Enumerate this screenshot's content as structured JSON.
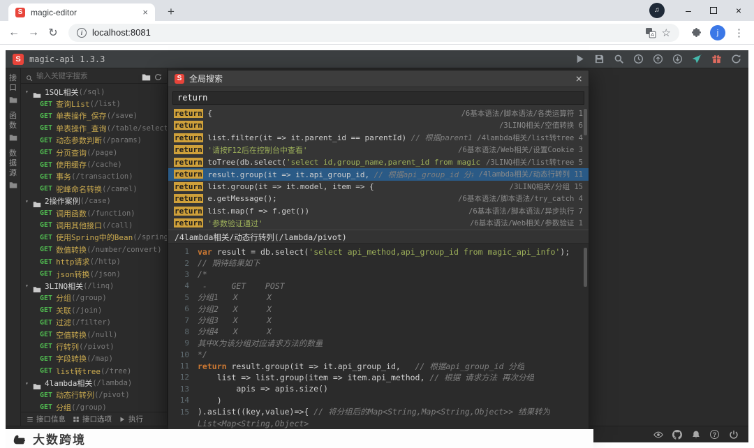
{
  "colors": {
    "brand_red": "#e8443a",
    "highlight_bg": "#cfa03a",
    "selected_row": "#2a5a86",
    "keyword": "#cc7832",
    "string": "#9eb15a",
    "comment": "#7f7f7f",
    "method_get": "#4fb84f",
    "app_bg": "#2b2b2b",
    "avatar_blue": "#3b78e7"
  },
  "browser": {
    "tab_title": "magic-editor",
    "url": "localhost:8081",
    "avatar_letter": "j",
    "icons": [
      "back-icon",
      "forward-icon",
      "reload-icon",
      "info-icon",
      "translate-icon",
      "bookmark-star-icon",
      "extensions-puzzle-icon",
      "profile-avatar",
      "menu-kebab-icon",
      "media-controls-icon",
      "minimize-icon",
      "maximize-icon",
      "close-icon",
      "new-tab-icon",
      "tab-close-icon"
    ]
  },
  "app": {
    "brand_letter": "S",
    "title": "magic-api 1.3.3",
    "header_icons": [
      {
        "name": "run-icon",
        "color": "#9aa0a6"
      },
      {
        "name": "save-icon",
        "color": "#9aa0a6"
      },
      {
        "name": "search-icon",
        "color": "#9aa0a6"
      },
      {
        "name": "history-icon",
        "color": "#9aa0a6"
      },
      {
        "name": "upload-icon",
        "color": "#9aa0a6"
      },
      {
        "name": "download-icon",
        "color": "#9aa0a6"
      },
      {
        "name": "send-icon",
        "color": "#45b8ac"
      },
      {
        "name": "gift-icon",
        "color": "#e06c60"
      },
      {
        "name": "refresh-icon",
        "color": "#9aa0a6"
      }
    ],
    "footer_icons": [
      {
        "name": "eye-icon"
      },
      {
        "name": "github-icon"
      },
      {
        "name": "bell-icon"
      },
      {
        "name": "help-icon"
      },
      {
        "name": "power-icon"
      }
    ]
  },
  "sidebar": {
    "search_placeholder": "输入关键字搜索",
    "panel_tabs": [
      {
        "label": "接口"
      },
      {
        "label": "函数"
      },
      {
        "label": "数据源"
      }
    ],
    "tree": [
      {
        "label": "1SQL相关",
        "path": "(/sql)",
        "children": [
          {
            "method": "GET",
            "label": "查询List",
            "path": "(/list)"
          },
          {
            "method": "GET",
            "label": "单表操作_保存",
            "path": "(/save)"
          },
          {
            "method": "GET",
            "label": "单表操作_查询",
            "path": "(/table/select"
          },
          {
            "method": "GET",
            "label": "动态参数判断",
            "path": "(/params)"
          },
          {
            "method": "GET",
            "label": "分页查询",
            "path": "(/page)"
          },
          {
            "method": "GET",
            "label": "使用缓存",
            "path": "(/cache)"
          },
          {
            "method": "GET",
            "label": "事务",
            "path": "(/transaction)"
          },
          {
            "method": "GET",
            "label": "驼峰命名转换",
            "path": "(/camel)"
          }
        ]
      },
      {
        "label": "2操作案例",
        "path": "(/case)",
        "children": [
          {
            "method": "GET",
            "label": "调用函数",
            "path": "(/function)"
          },
          {
            "method": "GET",
            "label": "调用其他接口",
            "path": "(/call)"
          },
          {
            "method": "GET",
            "label": "使用Spring中的Bean",
            "path": "(/spring"
          },
          {
            "method": "GET",
            "label": "数值转换",
            "path": "(/number/convert)"
          },
          {
            "method": "GET",
            "label": "http请求",
            "path": "(/http)"
          },
          {
            "method": "GET",
            "label": "json转换",
            "path": "(/json)"
          }
        ]
      },
      {
        "label": "3LINQ相关",
        "path": "(/linq)",
        "children": [
          {
            "method": "GET",
            "label": "分组",
            "path": "(/group)"
          },
          {
            "method": "GET",
            "label": "关联",
            "path": "(/join)"
          },
          {
            "method": "GET",
            "label": "过滤",
            "path": "(/filter)"
          },
          {
            "method": "GET",
            "label": "空值转换",
            "path": "(/null)"
          },
          {
            "method": "GET",
            "label": "行转列",
            "path": "(/pivot)"
          },
          {
            "method": "GET",
            "label": "字段转换",
            "path": "(/map)"
          },
          {
            "method": "GET",
            "label": "list转tree",
            "path": "(/tree)"
          }
        ]
      },
      {
        "label": "4lambda相关",
        "path": "(/lambda)",
        "children": [
          {
            "method": "GET",
            "label": "动态行转列",
            "path": "(/pivot)"
          },
          {
            "method": "GET",
            "label": "分组",
            "path": "(/group)"
          }
        ]
      }
    ],
    "footer": [
      {
        "name": "api-info",
        "icon": "list-icon",
        "label": "接口信息"
      },
      {
        "name": "api-options",
        "icon": "grid-icon",
        "label": "接口选项"
      },
      {
        "name": "run",
        "icon": "play-icon",
        "label": "执行"
      }
    ]
  },
  "modal": {
    "title": "全局搜索",
    "query": "return",
    "results": [
      {
        "keyword": "return",
        "segments": [
          {
            "text": " {",
            "type": "plain"
          }
        ],
        "path": "/6基本语法/脚本语法/各类运算符",
        "line": "1",
        "selected": false
      },
      {
        "keyword": "return",
        "segments": [],
        "path": "/3LINQ相关/空值转换",
        "line": "6",
        "selected": false
      },
      {
        "keyword": "return",
        "segments": [
          {
            "text": " list.filter(it => it.parent_id == parentId) ",
            "type": "plain"
          },
          {
            "text": "// 根据parentId",
            "type": "comment"
          }
        ],
        "path": "/4lambda相关/list转tree",
        "line": "4",
        "selected": false
      },
      {
        "keyword": "return",
        "segments": [
          {
            "text": " ",
            "type": "plain"
          },
          {
            "text": "'请按F12后在控制台中查看'",
            "type": "string"
          }
        ],
        "path": "/6基本语法/Web相关/设置Cookie",
        "line": "3",
        "selected": false
      },
      {
        "keyword": "return",
        "segments": [
          {
            "text": " toTree(db.select(",
            "type": "plain"
          },
          {
            "text": "'select id,group_name,parent_id from magic_g",
            "type": "string"
          }
        ],
        "path": "/3LINQ相关/list转tree",
        "line": "5",
        "selected": false
      },
      {
        "keyword": "return",
        "segments": [
          {
            "text": " result.group(it => it.api_group_id, ",
            "type": "plain"
          },
          {
            "text": "// 根据api_group_id 分组",
            "type": "comment"
          }
        ],
        "path": "/4lambda相关/动态行转列",
        "line": "11",
        "selected": true
      },
      {
        "keyword": "return",
        "segments": [
          {
            "text": " list.group(it => it.model, item => {",
            "type": "plain"
          }
        ],
        "path": "/3LINQ相关/分组",
        "line": "15",
        "selected": false
      },
      {
        "keyword": "return",
        "segments": [
          {
            "text": " e.getMessage();",
            "type": "plain"
          }
        ],
        "path": "/6基本语法/脚本语法/try_catch",
        "line": "4",
        "selected": false
      },
      {
        "keyword": "return",
        "segments": [
          {
            "text": " list.map(f => f.get())",
            "type": "plain"
          }
        ],
        "path": "/6基本语法/脚本语法/异步执行",
        "line": "7",
        "selected": false
      },
      {
        "keyword": "return",
        "segments": [
          {
            "text": " ",
            "type": "plain"
          },
          {
            "text": "'参数验证通过'",
            "type": "string"
          }
        ],
        "path": "/6基本语法/Web相关/参数验证",
        "line": "1",
        "selected": false
      }
    ],
    "preview": {
      "title": "/4lambda相关/动态行转列(/lambda/pivot)",
      "lines": [
        {
          "n": "1",
          "segments": [
            {
              "text": "var",
              "type": "keyword"
            },
            {
              "text": " result = db.select(",
              "type": "plain"
            },
            {
              "text": "'select api_method,api_group_id from magic_api_info'",
              "type": "string"
            },
            {
              "text": ");",
              "type": "plain"
            }
          ]
        },
        {
          "n": "2",
          "segments": [
            {
              "text": "// 期待结果如下",
              "type": "comment"
            }
          ]
        },
        {
          "n": "3",
          "segments": [
            {
              "text": "/*",
              "type": "comment"
            }
          ]
        },
        {
          "n": "4",
          "segments": [
            {
              "text": " -     GET    POST",
              "type": "comment"
            }
          ]
        },
        {
          "n": "5",
          "segments": [
            {
              "text": "分组1   X      X",
              "type": "comment"
            }
          ]
        },
        {
          "n": "6",
          "segments": [
            {
              "text": "分组2   X      X",
              "type": "comment"
            }
          ]
        },
        {
          "n": "7",
          "segments": [
            {
              "text": "分组3   X      X",
              "type": "comment"
            }
          ]
        },
        {
          "n": "8",
          "segments": [
            {
              "text": "分组4   X      X",
              "type": "comment"
            }
          ]
        },
        {
          "n": "9",
          "segments": [
            {
              "text": "其中X为该分组对应请求方法的数量",
              "type": "comment"
            }
          ]
        },
        {
          "n": "10",
          "segments": [
            {
              "text": "*/",
              "type": "comment"
            }
          ]
        },
        {
          "n": "11",
          "segments": [
            {
              "text": "return",
              "type": "keyword"
            },
            {
              "text": " result.group(it => it.api_group_id,   ",
              "type": "plain"
            },
            {
              "text": "// 根据api_group_id 分组",
              "type": "comment"
            }
          ]
        },
        {
          "n": "12",
          "segments": [
            {
              "text": "    list => list.group(item => item.api_method, ",
              "type": "plain"
            },
            {
              "text": "// 根据 请求方法 再次分组",
              "type": "comment"
            }
          ]
        },
        {
          "n": "13",
          "segments": [
            {
              "text": "        apis => apis.size()",
              "type": "plain"
            }
          ]
        },
        {
          "n": "14",
          "segments": [
            {
              "text": "    )",
              "type": "plain"
            }
          ]
        },
        {
          "n": "15",
          "segments": [
            {
              "text": ").asList((key,value)=>{ ",
              "type": "plain"
            },
            {
              "text": "// 将分组后的Map<String,Map<String,Object>> 结果转为",
              "type": "comment"
            }
          ]
        },
        {
          "n": "",
          "segments": [
            {
              "text": "List<Map<String,Object>",
              "type": "comment"
            }
          ]
        }
      ]
    }
  },
  "watermark": {
    "text": "大数跨境"
  }
}
